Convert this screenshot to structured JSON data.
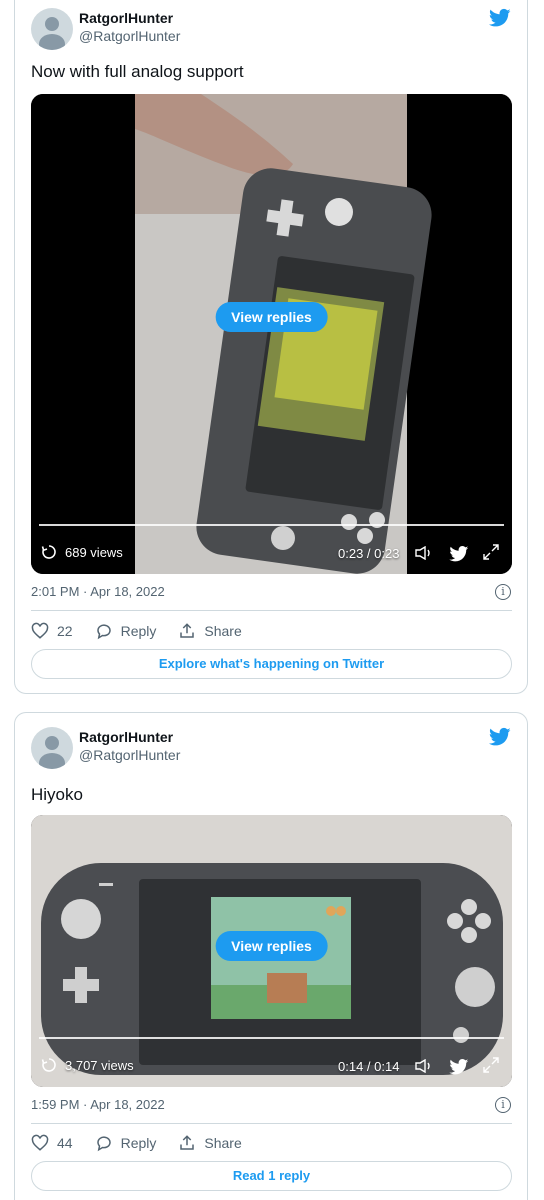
{
  "tweets": [
    {
      "user": {
        "name": "RatgorlHunter",
        "handle": "@RatgorlHunter"
      },
      "text": "Now with full analog support",
      "media": {
        "view_replies_label": "View replies",
        "views": "689 views",
        "time": "0:23 / 0:23"
      },
      "timestamp": "2:01 PM · Apr 18, 2022",
      "likes": "22",
      "reply_label": "Reply",
      "share_label": "Share",
      "cta": "Explore what's happening on Twitter"
    },
    {
      "user": {
        "name": "RatgorlHunter",
        "handle": "@RatgorlHunter"
      },
      "text": "Hiyoko",
      "media": {
        "view_replies_label": "View replies",
        "views": "3,707 views",
        "time": "0:14 / 0:14"
      },
      "timestamp": "1:59 PM · Apr 18, 2022",
      "likes": "44",
      "reply_label": "Reply",
      "share_label": "Share",
      "cta": "Read 1 reply"
    }
  ],
  "colors": {
    "accent": "#1d9bf0",
    "muted": "#536471",
    "border": "#cfd9de"
  },
  "icons": [
    "twitter-bird-icon",
    "replay-icon",
    "volume-icon",
    "fullscreen-icon",
    "heart-icon",
    "reply-icon",
    "share-icon",
    "info-icon"
  ]
}
